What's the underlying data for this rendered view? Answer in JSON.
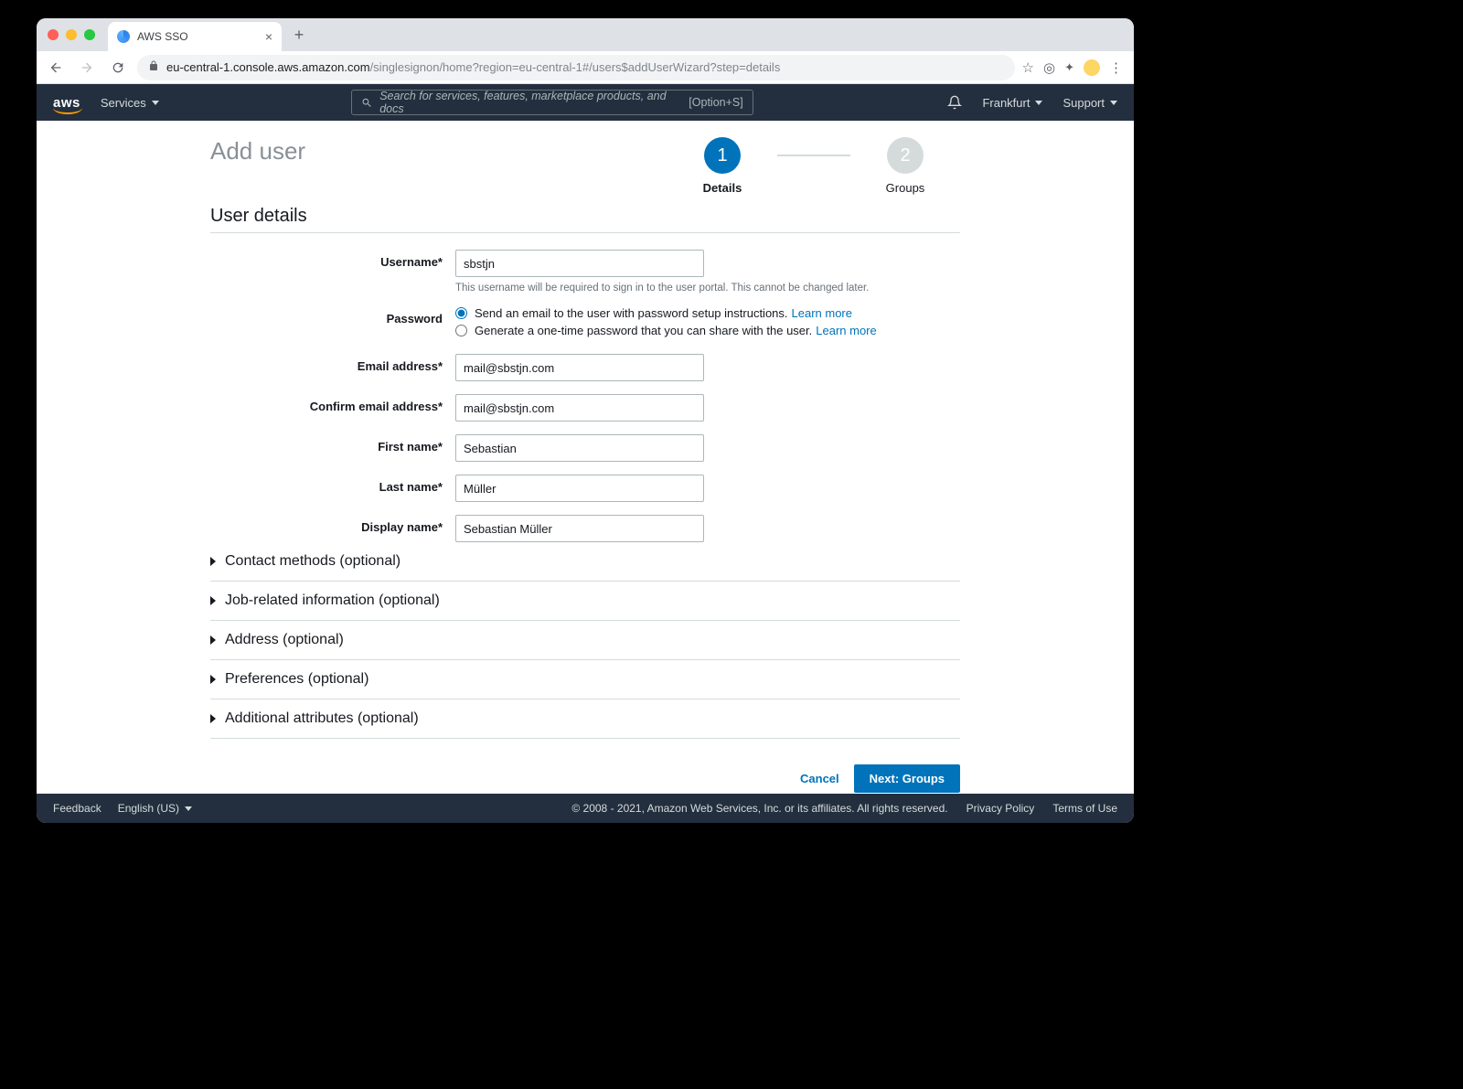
{
  "browser": {
    "tab_title": "AWS SSO",
    "url_host": "eu-central-1.console.aws.amazon.com",
    "url_path": "/singlesignon/home?region=eu-central-1#/users$addUserWizard?step=details"
  },
  "header": {
    "services": "Services",
    "search_placeholder": "Search for services, features, marketplace products, and docs",
    "search_shortcut": "[Option+S]",
    "region": "Frankfurt",
    "support": "Support"
  },
  "page": {
    "title": "Add user",
    "steps": [
      {
        "num": "1",
        "label": "Details"
      },
      {
        "num": "2",
        "label": "Groups"
      }
    ],
    "section_heading": "User details"
  },
  "form": {
    "username": {
      "label": "Username*",
      "value": "sbstjn",
      "hint": "This username will be required to sign in to the user portal. This cannot be changed later."
    },
    "password": {
      "label": "Password",
      "opt1": "Send an email to the user with password setup instructions.",
      "opt2": "Generate a one-time password that you can share with the user.",
      "learn_more": "Learn more"
    },
    "email": {
      "label": "Email address*",
      "value": "mail@sbstjn.com"
    },
    "confirm_email": {
      "label": "Confirm email address*",
      "value": "mail@sbstjn.com"
    },
    "first_name": {
      "label": "First name*",
      "value": "Sebastian"
    },
    "last_name": {
      "label": "Last name*",
      "value": "Müller"
    },
    "display_name": {
      "label": "Display name*",
      "value": "Sebastian Müller"
    }
  },
  "accordions": [
    "Contact methods (optional)",
    "Job-related information (optional)",
    "Address (optional)",
    "Preferences (optional)",
    "Additional attributes (optional)"
  ],
  "actions": {
    "cancel": "Cancel",
    "next": "Next: Groups"
  },
  "footer": {
    "feedback": "Feedback",
    "language": "English (US)",
    "copyright": "© 2008 - 2021, Amazon Web Services, Inc. or its affiliates. All rights reserved.",
    "privacy": "Privacy Policy",
    "terms": "Terms of Use"
  }
}
